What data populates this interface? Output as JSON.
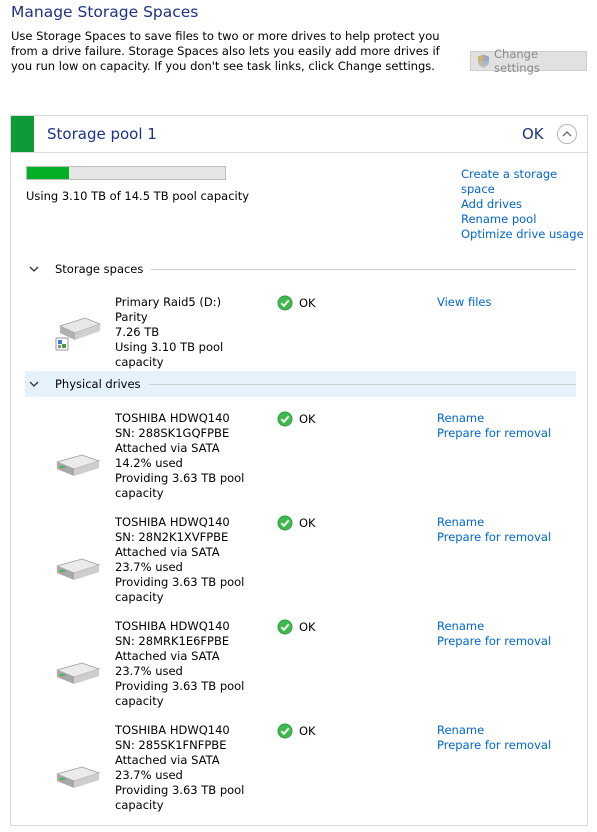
{
  "page": {
    "title": "Manage Storage Spaces",
    "intro": "Use Storage Spaces to save files to two or more drives to help protect you from a drive failure. Storage Spaces also lets you easily add more drives if you run low on capacity. If you don't see task links, click Change settings.",
    "change_settings": "Change settings"
  },
  "pool": {
    "name": "Storage pool 1",
    "status": "OK",
    "used_fraction": 0.213,
    "capacity_text": "Using 3.10 TB of 14.5 TB pool capacity",
    "links": [
      "Create a storage space",
      "Add drives",
      "Rename pool",
      "Optimize drive usage"
    ]
  },
  "storage_spaces": {
    "label": "Storage spaces",
    "items": [
      {
        "name": "Primary Raid5 (D:)",
        "resiliency": "Parity",
        "size": "7.26 TB",
        "usage": "Using 3.10 TB pool capacity",
        "status": "OK",
        "action": "View files"
      }
    ]
  },
  "physical_drives": {
    "label": "Physical drives",
    "items": [
      {
        "model": "TOSHIBA HDWQ140",
        "sn": "SN: 288SK1GQFPBE",
        "connection": "Attached via SATA",
        "used": "14.2% used",
        "providing": "Providing 3.63 TB pool capacity",
        "status": "OK",
        "rename": "Rename",
        "remove": "Prepare for removal"
      },
      {
        "model": "TOSHIBA HDWQ140",
        "sn": "SN: 28N2K1XVFPBE",
        "connection": "Attached via SATA",
        "used": "23.7% used",
        "providing": "Providing 3.63 TB pool capacity",
        "status": "OK",
        "rename": "Rename",
        "remove": "Prepare for removal"
      },
      {
        "model": "TOSHIBA HDWQ140",
        "sn": "SN: 28MRK1E6FPBE",
        "connection": "Attached via SATA",
        "used": "23.7% used",
        "providing": "Providing 3.63 TB pool capacity",
        "status": "OK",
        "rename": "Rename",
        "remove": "Prepare for removal"
      },
      {
        "model": "TOSHIBA HDWQ140",
        "sn": "SN: 285SK1FNFPBE",
        "connection": "Attached via SATA",
        "used": "23.7% used",
        "providing": "Providing 3.63 TB pool capacity",
        "status": "OK",
        "rename": "Rename",
        "remove": "Prepare for removal"
      }
    ]
  },
  "colors": {
    "accent_green": "#0e9a38",
    "progress_green": "#06b025",
    "title_blue": "#1e3287",
    "link_blue": "#0066cc",
    "highlight": "#e5f1fb"
  }
}
